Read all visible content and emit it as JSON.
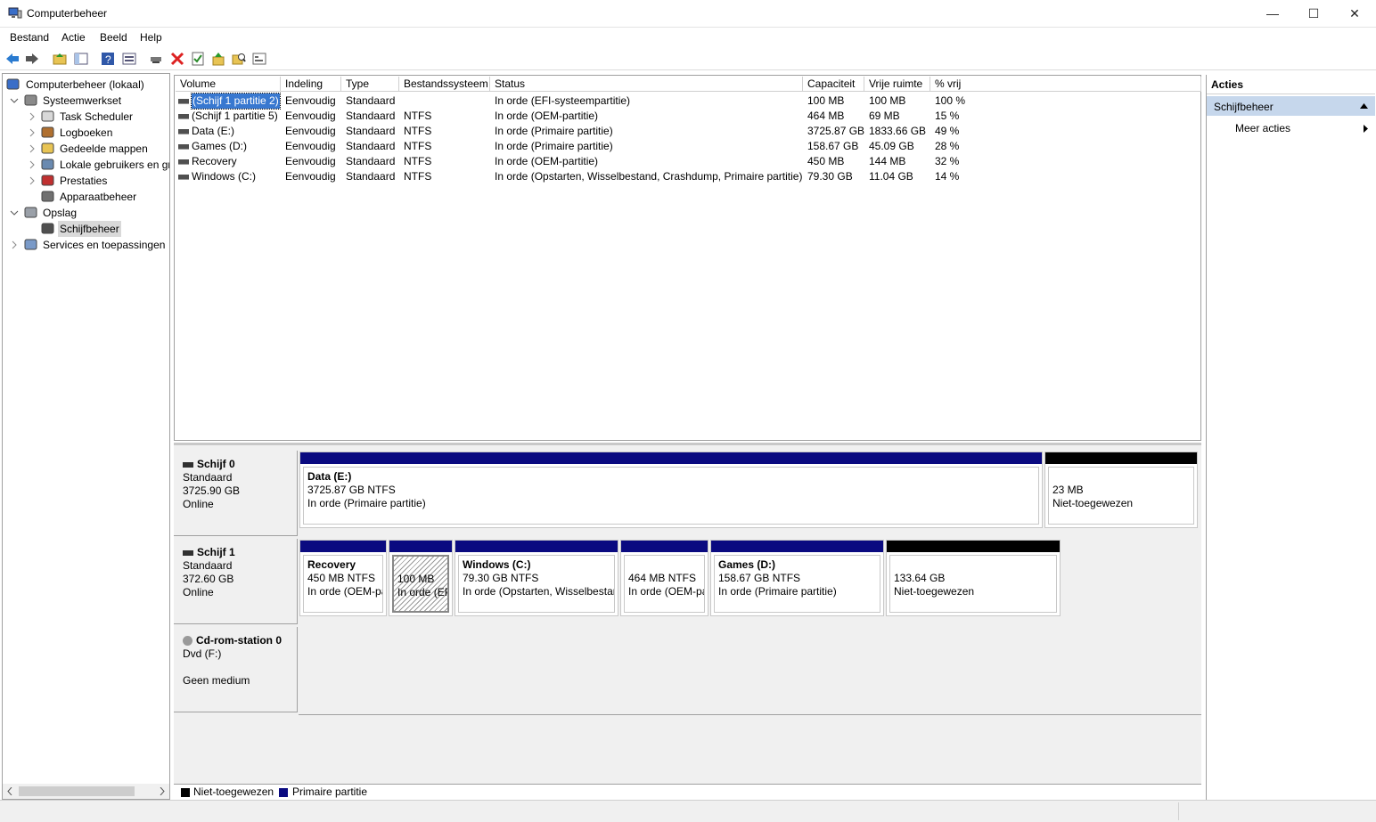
{
  "window": {
    "title": "Computerbeheer",
    "minimize_glyph": "—",
    "maximize_glyph": "☐",
    "close_glyph": "✕"
  },
  "menu": [
    "Bestand",
    "Actie",
    "Beeld",
    "Help"
  ],
  "toolbar": {
    "icons": [
      "back-arrow-icon",
      "forward-arrow-icon",
      "up-folder-icon",
      "show-tree-icon",
      "help-icon",
      "properties-view-icon",
      "connect-icon",
      "delete-icon",
      "check-icon",
      "import-icon",
      "search-icon",
      "console-icon"
    ]
  },
  "tree": [
    {
      "label": "Computerbeheer (lokaal)",
      "level": 0,
      "icon": "computer-management-icon",
      "expander": ""
    },
    {
      "label": "Systeemwerkset",
      "level": 1,
      "icon": "tools-icon",
      "expander": "v"
    },
    {
      "label": "Task Scheduler",
      "level": 2,
      "icon": "clock-icon",
      "expander": ">"
    },
    {
      "label": "Logboeken",
      "level": 2,
      "icon": "event-viewer-icon",
      "expander": ">"
    },
    {
      "label": "Gedeelde mappen",
      "level": 2,
      "icon": "shared-folder-icon",
      "expander": ">"
    },
    {
      "label": "Lokale gebruikers en gr",
      "level": 2,
      "icon": "users-icon",
      "expander": ">"
    },
    {
      "label": "Prestaties",
      "level": 2,
      "icon": "performance-icon",
      "expander": ">"
    },
    {
      "label": "Apparaatbeheer",
      "level": 2,
      "icon": "device-manager-icon",
      "expander": ""
    },
    {
      "label": "Opslag",
      "level": 1,
      "icon": "storage-icon",
      "expander": "v"
    },
    {
      "label": "Schijfbeheer",
      "level": 2,
      "icon": "disk-management-icon",
      "expander": "",
      "selected": true
    },
    {
      "label": "Services en toepassingen",
      "level": 1,
      "icon": "services-icon",
      "expander": ">"
    }
  ],
  "volumes": {
    "columns": [
      "Volume",
      "Indeling",
      "Type",
      "Bestandssysteem",
      "Status",
      "Capaciteit",
      "Vrije ruimte",
      "% vrij"
    ],
    "rows": [
      [
        "(Schijf 1 partitie 2)",
        "Eenvoudig",
        "Standaard",
        "",
        "In orde (EFI-systeempartitie)",
        "100 MB",
        "100 MB",
        "100 %"
      ],
      [
        "(Schijf 1 partitie 5)",
        "Eenvoudig",
        "Standaard",
        "NTFS",
        "In orde (OEM-partitie)",
        "464 MB",
        "69 MB",
        "15 %"
      ],
      [
        "Data (E:)",
        "Eenvoudig",
        "Standaard",
        "NTFS",
        "In orde (Primaire partitie)",
        "3725.87 GB",
        "1833.66 GB",
        "49 %"
      ],
      [
        "Games (D:)",
        "Eenvoudig",
        "Standaard",
        "NTFS",
        "In orde (Primaire partitie)",
        "158.67 GB",
        "45.09 GB",
        "28 %"
      ],
      [
        "Recovery",
        "Eenvoudig",
        "Standaard",
        "NTFS",
        "In orde (OEM-partitie)",
        "450 MB",
        "144 MB",
        "32 %"
      ],
      [
        "Windows (C:)",
        "Eenvoudig",
        "Standaard",
        "NTFS",
        "In orde (Opstarten, Wisselbestand, Crashdump, Primaire partitie)",
        "79.30 GB",
        "11.04 GB",
        "14 %"
      ]
    ]
  },
  "disks": [
    {
      "name": "Schijf 0",
      "line1": "Standaard",
      "line2": "3725.90 GB",
      "line3": "Online",
      "partitions": [
        {
          "title": "Data  (E:)",
          "line1": "3725.87 GB NTFS",
          "line2": "In orde (Primaire partitie)",
          "kind": "primary"
        },
        {
          "title": "",
          "line1": "23 MB",
          "line2": "Niet-toegewezen",
          "kind": "unallocated"
        }
      ]
    },
    {
      "name": "Schijf 1",
      "line1": "Standaard",
      "line2": "372.60 GB",
      "line3": "Online",
      "partitions": [
        {
          "title": "Recovery",
          "line1": "450 MB NTFS",
          "line2": "In orde (OEM-pa",
          "kind": "primary"
        },
        {
          "title": "",
          "line1": "100 MB",
          "line2": "In orde (EFI",
          "kind": "primary",
          "selected": true
        },
        {
          "title": "Windows  (C:)",
          "line1": "79.30 GB NTFS",
          "line2": "In orde (Opstarten, Wisselbestan",
          "kind": "primary"
        },
        {
          "title": "",
          "line1": "464 MB NTFS",
          "line2": "In orde (OEM-pa",
          "kind": "primary"
        },
        {
          "title": "Games  (D:)",
          "line1": "158.67 GB NTFS",
          "line2": "In orde (Primaire partitie)",
          "kind": "primary"
        },
        {
          "title": "",
          "line1": "133.64 GB",
          "line2": "Niet-toegewezen",
          "kind": "unallocated"
        }
      ]
    },
    {
      "name": "Cd-rom-station 0",
      "line1": "Dvd (F:)",
      "line2": "",
      "line3": "Geen medium",
      "partitions": []
    }
  ],
  "legend": [
    {
      "label": "Niet-toegewezen",
      "color": "#000000"
    },
    {
      "label": "Primaire partitie",
      "color": "#0a0a80"
    }
  ],
  "actions": {
    "header": "Acties",
    "section": "Schijfbeheer",
    "item": "Meer acties"
  },
  "colors": {
    "primary": "#0a0a80",
    "unallocated": "#000000",
    "selection": "#cce8ff",
    "actions_section": "#c6d7ec"
  }
}
